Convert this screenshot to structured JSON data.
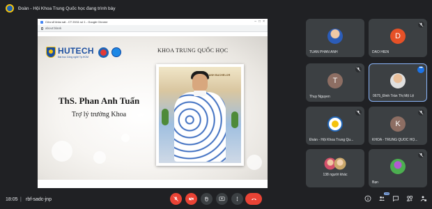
{
  "header": {
    "presenting_text": "Đoàn - Hội Khoa Trung Quốc học đang trình bày"
  },
  "shared_window": {
    "chrome_title": "Cửa sổ khảo sát - CT 20/11 số 1 - Google Chrome",
    "address": "about:blank"
  },
  "slide": {
    "logo_name": "HUTECH",
    "logo_sub": "Đại học Công nghệ Tp.HCM",
    "faculty": "KHOA TRUNG QUỐC HỌC",
    "speaker_name": "ThS. Phan Anh Tuấn",
    "speaker_role": "Trợ lý trưởng Khoa",
    "photo_sign": "DOANH BACHELOR"
  },
  "participants": [
    {
      "name": "TUAN PHAN ANH",
      "avatar": "photo",
      "mic_off": false
    },
    {
      "name": "DAO HIEN",
      "avatar": "D",
      "avatar_color": "#e65127",
      "mic_off": true
    },
    {
      "name": "Thuy Nguyen",
      "avatar": "T",
      "avatar_color": "#8d6e63",
      "mic_off": true
    },
    {
      "name": "0675_Đinh Trần Thị Mộ Lệ",
      "avatar": "photo",
      "mic_off": false,
      "active": true
    },
    {
      "name": "Đoàn - Hội Khoa Trung Qu...",
      "avatar": "logo",
      "mic_off": true
    },
    {
      "name": "KHOA - TRUNG QUỐC HỌ...",
      "avatar": "K",
      "avatar_color": "#8d6e63",
      "mic_off": true
    },
    {
      "name": "138 người khác",
      "avatar": "group"
    },
    {
      "name": "Bạn",
      "avatar": "photo",
      "mic_off": true
    }
  ],
  "bottom": {
    "time": "18:05",
    "separator": "|",
    "meeting_code": "rbf-sadc-jnp",
    "participant_count": "144"
  },
  "colors": {
    "background": "#202124",
    "tile": "#3c4043",
    "active_border": "#8ab4f8",
    "danger": "#ea4335",
    "accent": "#1a73e8"
  }
}
